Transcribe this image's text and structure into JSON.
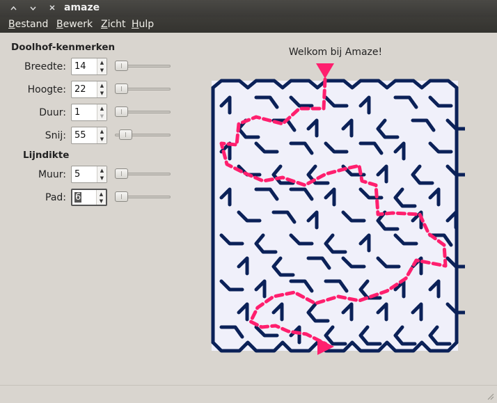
{
  "window": {
    "title": "amaze"
  },
  "menu": [
    {
      "accel": "B",
      "rest": "estand"
    },
    {
      "accel": "B",
      "rest": "ewerk"
    },
    {
      "accel": "Z",
      "rest": "icht"
    },
    {
      "accel": "H",
      "rest": "ulp"
    }
  ],
  "sections": {
    "maze": "Doolhof-kenmerken",
    "line": "Lijndikte"
  },
  "fields": {
    "width": {
      "label": "Breedte:",
      "value": "14"
    },
    "height": {
      "label": "Hoogte:",
      "value": "22"
    },
    "duration": {
      "label": "Duur:",
      "value": "1"
    },
    "cut": {
      "label": "Snij:",
      "value": "55"
    },
    "wall": {
      "label": "Muur:",
      "value": "5"
    },
    "path": {
      "label": "Pad:",
      "value": "6"
    }
  },
  "sliders": {
    "width": 0,
    "height": 0,
    "duration": 0,
    "cut": 0.1,
    "wall": 0,
    "path": 0
  },
  "welcome": "Welkom bij Amaze!",
  "colors": {
    "wall": "#0b2158",
    "path": "#ff1f6e",
    "maze_bg": "#f0f0fa"
  },
  "icons": {
    "grip": "resize-grip-icon"
  }
}
